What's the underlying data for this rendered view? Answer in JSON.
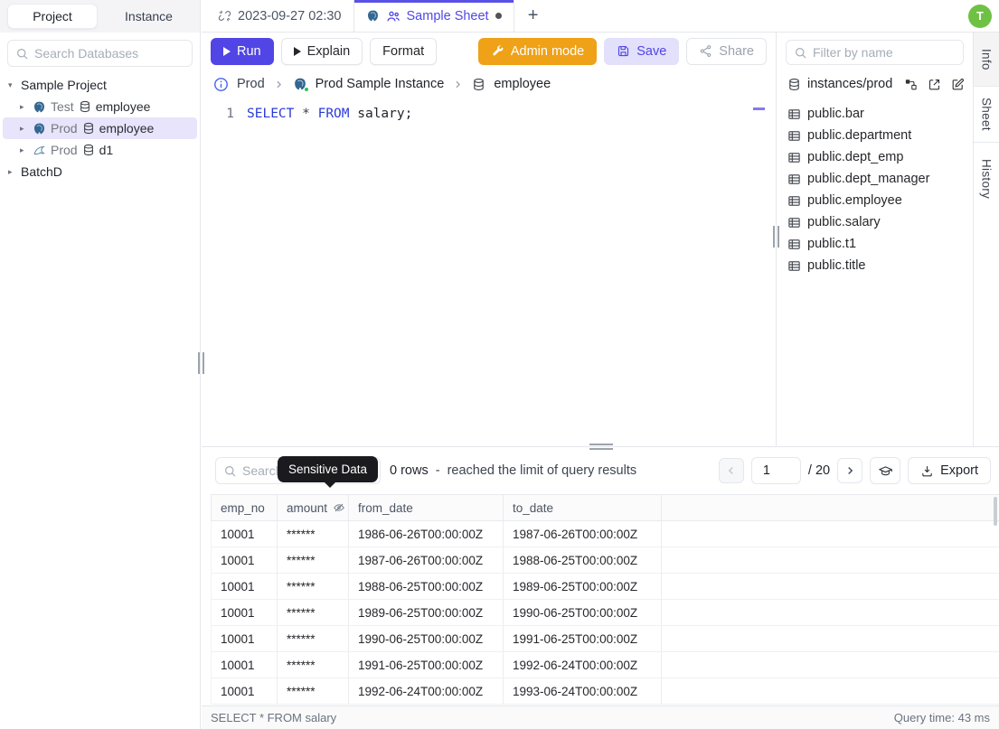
{
  "colors": {
    "accent_indigo": "#5145e5",
    "admin_orange": "#efa117",
    "avatar_green": "#6fc143",
    "selected_row": "#e7e4fb",
    "tooltip_bg": "#1b1b1f",
    "keyword_blue": "#2a3bd6",
    "postgres_blue": "#336791",
    "status_green": "#2fc150"
  },
  "icons": {
    "search": "magnifier",
    "unlink": "broken-chain",
    "people": "two-users",
    "info": "circle-i",
    "wrench": "wrench",
    "save": "floppy-disk",
    "share": "share-nodes",
    "export": "download-tray",
    "masking": "graduation-cap",
    "masked_column": "eye-off",
    "schema_diagram": "connected-squares",
    "external_link": "arrow-out-of-box",
    "edit": "pencil-square",
    "database": "db-cylinder",
    "table": "grid-table",
    "postgres": "elephant",
    "mysql": "dolphin"
  },
  "sidebar": {
    "tabs": {
      "project": "Project",
      "instance": "Instance"
    },
    "search_placeholder": "Search Databases",
    "tree": {
      "project_1": "Sample Project",
      "item_1": {
        "env": "Test",
        "db": "employee"
      },
      "item_2": {
        "env": "Prod",
        "db": "employee"
      },
      "item_3": {
        "env": "Prod",
        "db": "d1"
      },
      "project_2": "BatchD"
    }
  },
  "tabbar": {
    "tab_history": "2023-09-27 02:30",
    "tab_sheet": "Sample Sheet",
    "new_tab": "+",
    "avatar": "T"
  },
  "toolbar": {
    "run": "Run",
    "explain": "Explain",
    "format": "Format",
    "admin_mode": "Admin mode",
    "save": "Save",
    "share": "Share"
  },
  "breadcrumb": {
    "environment": "Prod",
    "instance": "Prod Sample Instance",
    "database": "employee"
  },
  "editor": {
    "line_number": "1",
    "sql": {
      "keyword_select": "SELECT",
      "star": " * ",
      "keyword_from": "FROM",
      "tail": " salary;"
    }
  },
  "schema_panel": {
    "filter_placeholder": "Filter by name",
    "scope": "instances/prod",
    "tables": [
      "public.bar",
      "public.department",
      "public.dept_emp",
      "public.dept_manager",
      "public.employee",
      "public.salary",
      "public.t1",
      "public.title"
    ]
  },
  "side_tabs": {
    "info": "Info",
    "sheet": "Sheet",
    "history": "History"
  },
  "results": {
    "search_placeholder": "Search",
    "tooltip": "Sensitive Data",
    "rows_count": "0 rows",
    "separator": "-",
    "limit_note": "reached the limit of query results",
    "page": "1",
    "page_total": "/ 20",
    "export": "Export",
    "columns": {
      "c1": "emp_no",
      "c2": "amount",
      "c3": "from_date",
      "c4": "to_date"
    },
    "rows": [
      [
        "10001",
        "******",
        "1986-06-26T00:00:00Z",
        "1987-06-26T00:00:00Z"
      ],
      [
        "10001",
        "******",
        "1987-06-26T00:00:00Z",
        "1988-06-25T00:00:00Z"
      ],
      [
        "10001",
        "******",
        "1988-06-25T00:00:00Z",
        "1989-06-25T00:00:00Z"
      ],
      [
        "10001",
        "******",
        "1989-06-25T00:00:00Z",
        "1990-06-25T00:00:00Z"
      ],
      [
        "10001",
        "******",
        "1990-06-25T00:00:00Z",
        "1991-06-25T00:00:00Z"
      ],
      [
        "10001",
        "******",
        "1991-06-25T00:00:00Z",
        "1992-06-24T00:00:00Z"
      ],
      [
        "10001",
        "******",
        "1992-06-24T00:00:00Z",
        "1993-06-24T00:00:00Z"
      ]
    ],
    "status_query": "SELECT * FROM salary",
    "query_time": "Query time: 43 ms"
  }
}
